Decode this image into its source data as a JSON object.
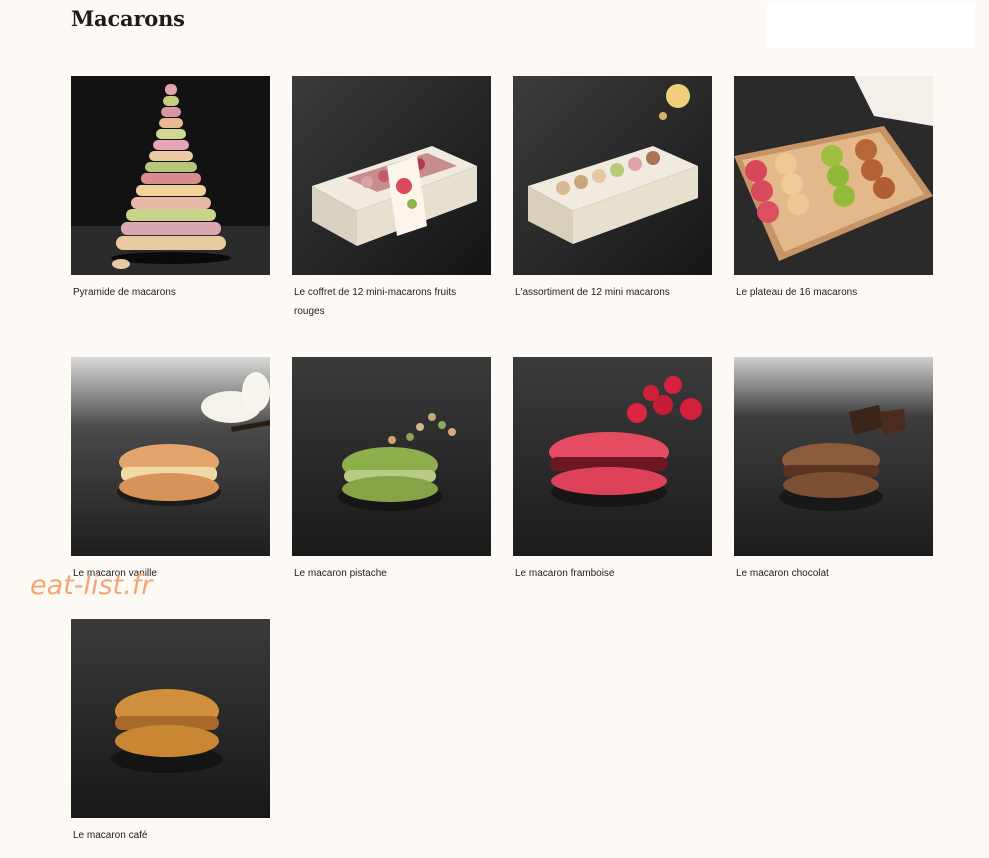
{
  "page": {
    "title": "Macarons"
  },
  "watermark": "eat-list.fr",
  "products": [
    {
      "name": "Pyramide de macarons",
      "image": "macaron-tower-image"
    },
    {
      "name": "Le coffret de 12 mini-macarons fruits rouges",
      "image": "gift-box-image"
    },
    {
      "name": "L'assortiment de 12 mini macarons",
      "image": "assortment-box-image"
    },
    {
      "name": "Le plateau de 16 macarons",
      "image": "tray-image"
    },
    {
      "name": "Le macaron vanille",
      "image": "vanilla-macaron-image"
    },
    {
      "name": "Le macaron pistache",
      "image": "pistachio-macaron-image"
    },
    {
      "name": "Le macaron framboise",
      "image": "raspberry-macaron-image"
    },
    {
      "name": "Le macaron chocolat",
      "image": "chocolate-macaron-image"
    },
    {
      "name": "Le macaron café",
      "image": "coffee-macaron-image"
    }
  ],
  "colors": {
    "background": "#fdfaf5",
    "slate": "#2a2a2a",
    "watermark": "#f0a778"
  }
}
